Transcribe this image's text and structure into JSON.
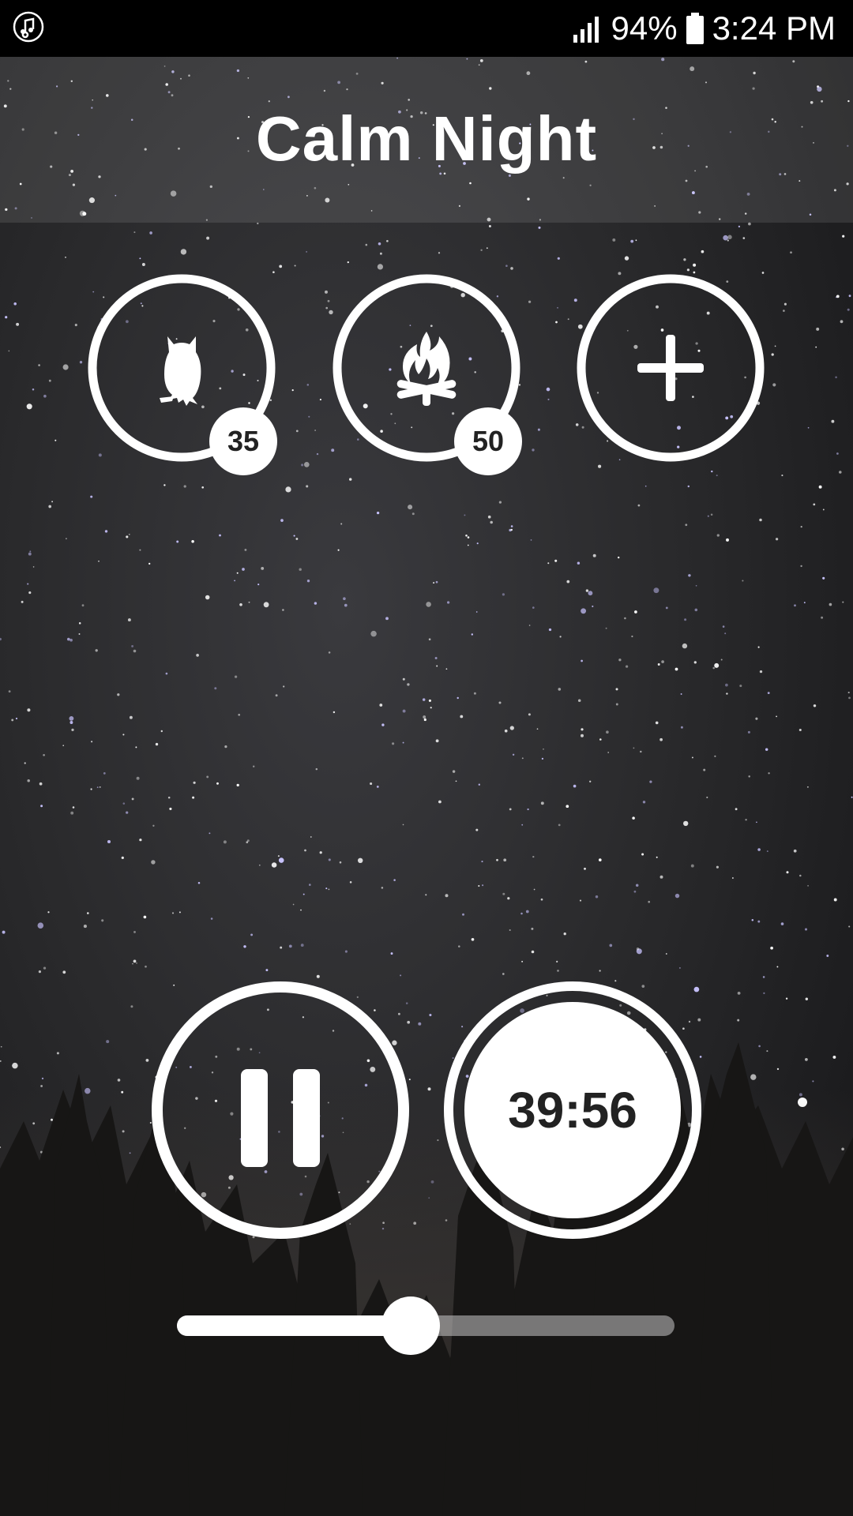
{
  "status_bar": {
    "battery": "94%",
    "time": "3:24 PM",
    "icons": [
      "music-note-icon",
      "signal-icon",
      "battery-icon"
    ]
  },
  "header": {
    "title": "Calm Night"
  },
  "sounds": [
    {
      "icon": "owl-icon",
      "volume": "35",
      "level": 0.35
    },
    {
      "icon": "campfire-icon",
      "volume": "50",
      "level": 0.5
    }
  ],
  "add_sound": {
    "icon": "plus-icon"
  },
  "playback": {
    "state_icon": "pause-icon",
    "timer": "39:56"
  },
  "volume": {
    "level": 0.47
  },
  "colors": {
    "foreground": "#ffffff",
    "badge_text": "#222222",
    "track": "#b0b0b0"
  }
}
